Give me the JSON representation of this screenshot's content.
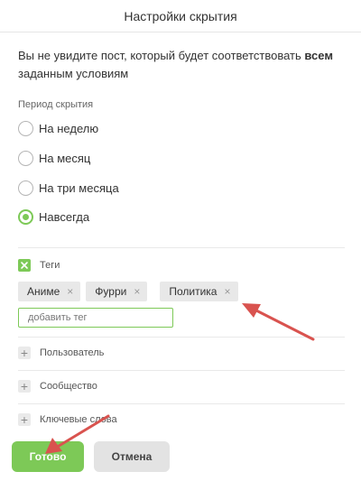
{
  "header": {
    "title": "Настройки скрытия"
  },
  "description": {
    "text_before": "Вы не увидите пост, который будет соответствовать ",
    "text_bold": "всем",
    "text_after": " заданным условиям"
  },
  "period": {
    "label": "Период скрытия",
    "options": [
      {
        "label": "На неделю",
        "checked": false
      },
      {
        "label": "На месяц",
        "checked": false
      },
      {
        "label": "На три месяца",
        "checked": false
      },
      {
        "label": "Навсегда",
        "checked": true
      }
    ]
  },
  "tags": {
    "title": "Теги",
    "checked": true,
    "chips": [
      "Аниме",
      "Фурри",
      "Политика"
    ],
    "remove_glyph": "×",
    "input_placeholder": "добавить тег"
  },
  "sections": [
    {
      "label": "Пользователь"
    },
    {
      "label": "Сообщество"
    },
    {
      "label": "Ключевые слова"
    }
  ],
  "buttons": {
    "done": "Готово",
    "cancel": "Отмена"
  },
  "colors": {
    "accent": "#7dc957",
    "annotation_arrow": "#d9534f"
  }
}
